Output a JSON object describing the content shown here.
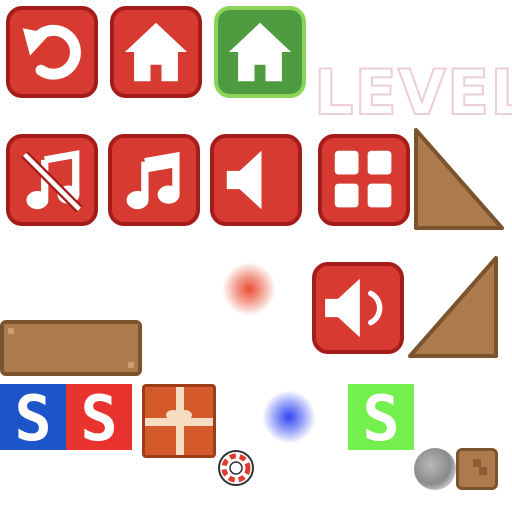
{
  "level_label": "LEVEL",
  "s_tiles": [
    {
      "glyph": "S",
      "color": "#1d54c9"
    },
    {
      "glyph": "S",
      "color": "#e8332f"
    },
    {
      "glyph": "S",
      "color": "#74f04e"
    }
  ],
  "icons": {
    "restart": "restart-icon",
    "home": "home-icon",
    "home_selected": "home-icon",
    "music_off": "music-off-icon",
    "music_on": "music-note-icon",
    "sound_off": "speaker-muted-icon",
    "sound_on": "speaker-on-icon",
    "levels": "grid-icon"
  },
  "colors": {
    "button_red": "#d63a30",
    "button_red_border": "#a51d1b",
    "button_green": "#4f9b40",
    "button_green_border": "#8cd45a",
    "wood": "#ad7a4d"
  }
}
